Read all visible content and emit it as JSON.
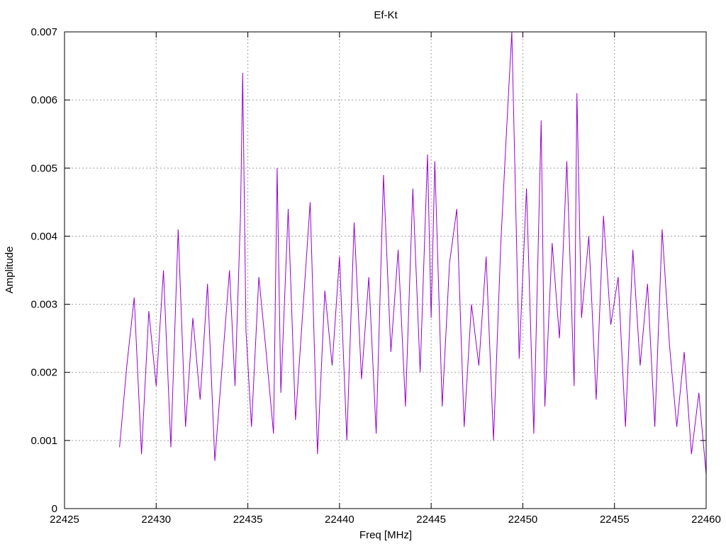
{
  "chart_data": {
    "type": "line",
    "title": "Ef-Kt",
    "xlabel": "Freq [MHz]",
    "ylabel": "Amplitude",
    "xlim": [
      22425,
      22460
    ],
    "ylim": [
      0,
      0.007
    ],
    "x_ticks": [
      22425,
      22430,
      22435,
      22440,
      22445,
      22450,
      22455,
      22460
    ],
    "x_tick_labels": [
      "22425",
      "22430",
      "22435",
      "22440",
      "22445",
      "22450",
      "22455",
      "22460"
    ],
    "y_ticks": [
      0,
      0.001,
      0.002,
      0.003,
      0.004,
      0.005,
      0.006,
      0.007
    ],
    "y_tick_labels": [
      "0",
      "0.001",
      "0.002",
      "0.003",
      "0.004",
      "0.005",
      "0.006",
      "0.007"
    ],
    "grid": true,
    "line_color": "#9400d3",
    "series": [
      {
        "x": [
          22428.0,
          22428.4,
          22428.8,
          22429.2,
          22429.6,
          22430.0,
          22430.4,
          22430.8,
          22431.2,
          22431.6,
          22432.0,
          22432.4,
          22432.8,
          22433.2,
          22433.6,
          22434.0,
          22434.3,
          22434.6,
          22434.72,
          22434.9,
          22435.2,
          22435.6,
          22436.0,
          22436.4,
          22436.6,
          22436.8,
          22437.2,
          22437.6,
          22438.0,
          22438.4,
          22438.8,
          22439.2,
          22439.6,
          22440.0,
          22440.4,
          22440.8,
          22441.2,
          22441.6,
          22442.0,
          22442.4,
          22442.8,
          22443.2,
          22443.6,
          22444.0,
          22444.4,
          22444.8,
          22445.0,
          22445.2,
          22445.6,
          22446.0,
          22446.4,
          22446.8,
          22447.2,
          22447.6,
          22448.0,
          22448.4,
          22448.8,
          22449.1,
          22449.4,
          22449.8,
          22450.2,
          22450.6,
          22451.0,
          22451.2,
          22451.6,
          22452.0,
          22452.4,
          22452.8,
          22452.95,
          22453.2,
          22453.6,
          22454.0,
          22454.4,
          22454.8,
          22455.2,
          22455.6,
          22456.0,
          22456.4,
          22456.8,
          22457.2,
          22457.6,
          22458.0,
          22458.4,
          22458.8,
          22459.2,
          22459.6,
          22460.0
        ],
        "y": [
          0.0009,
          0.0021,
          0.0031,
          0.0008,
          0.0029,
          0.0018,
          0.0035,
          0.0009,
          0.0041,
          0.0012,
          0.0028,
          0.0016,
          0.0033,
          0.0007,
          0.0021,
          0.0035,
          0.0018,
          0.0043,
          0.0064,
          0.0026,
          0.0012,
          0.0034,
          0.0023,
          0.0011,
          0.005,
          0.0017,
          0.0044,
          0.0013,
          0.0029,
          0.0045,
          0.0008,
          0.0032,
          0.0021,
          0.0037,
          0.001,
          0.0042,
          0.0019,
          0.0034,
          0.0011,
          0.0049,
          0.0023,
          0.0038,
          0.0015,
          0.0047,
          0.002,
          0.0052,
          0.0028,
          0.0051,
          0.0015,
          0.0036,
          0.0044,
          0.0012,
          0.003,
          0.0021,
          0.0037,
          0.001,
          0.0039,
          0.0055,
          0.007,
          0.0022,
          0.0047,
          0.0011,
          0.0057,
          0.0015,
          0.0039,
          0.0025,
          0.0051,
          0.0018,
          0.0061,
          0.0028,
          0.004,
          0.0016,
          0.0043,
          0.0027,
          0.0034,
          0.0012,
          0.0038,
          0.0021,
          0.0033,
          0.0012,
          0.0041,
          0.0024,
          0.0012,
          0.0023,
          0.0008,
          0.0017,
          0.0005
        ]
      }
    ]
  }
}
